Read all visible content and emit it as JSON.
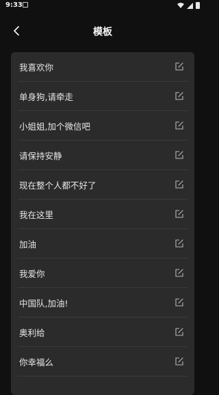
{
  "status_bar": {
    "time": "9:33",
    "icons": [
      "notification-icon",
      "wifi-icon",
      "signal-icon",
      "battery-icon"
    ]
  },
  "header": {
    "title": "模板",
    "back_icon": "chevron-left-icon"
  },
  "templates": [
    {
      "label": "我喜欢你"
    },
    {
      "label": "单身狗,请牵走"
    },
    {
      "label": "小姐姐,加个微信吧"
    },
    {
      "label": "请保持安静"
    },
    {
      "label": "现在整个人都不好了"
    },
    {
      "label": "我在这里"
    },
    {
      "label": "加油"
    },
    {
      "label": "我爱你"
    },
    {
      "label": "中国队,加油!"
    },
    {
      "label": "奥利给"
    },
    {
      "label": "你幸福么"
    }
  ],
  "colors": {
    "background": "#101010",
    "panel": "#2b2b2b",
    "divider": "#3b3b3b",
    "text": "#e6e6e6",
    "icon": "#b8b8b8"
  }
}
